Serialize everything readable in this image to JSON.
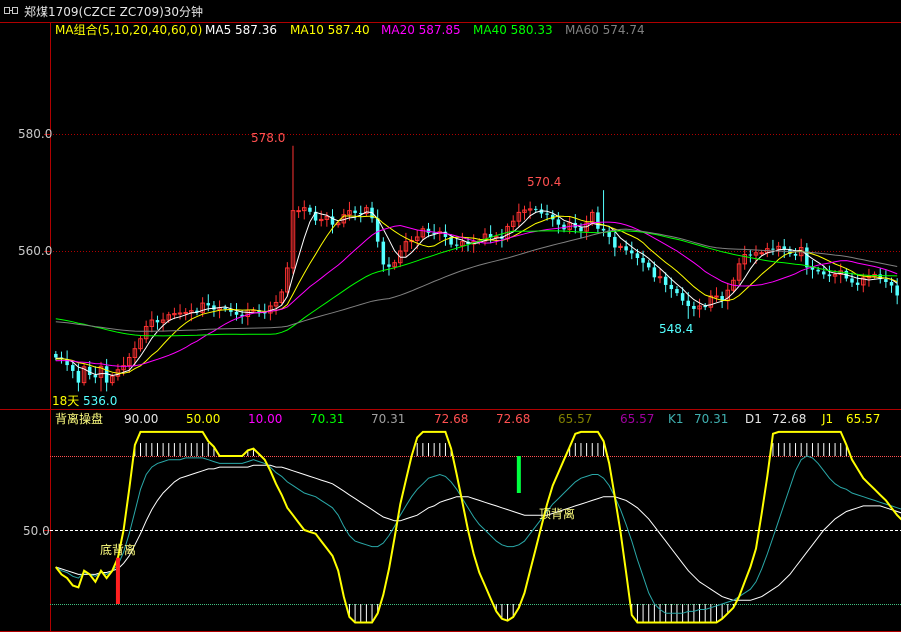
{
  "window_title": "郑煤1709(CZCE ZC709)30分钟",
  "colors": {
    "background": "#000000",
    "axis": "#b00000",
    "up_candle": "#ff3232",
    "down_candle": "#54ffff",
    "ma5": "#ffffff",
    "ma10": "#ffff00",
    "ma20": "#ff00ff",
    "ma40": "#00ff00",
    "ma60": "#808080",
    "k_line": "#ffff00",
    "d_line": "#ffffff",
    "j_line": "#2aa8a8"
  },
  "main_panel": {
    "ma_legend": {
      "group_label": "MA组合(5,10,20,40,60,0)",
      "ma5": "MA5 587.36",
      "ma10": "MA10 587.40",
      "ma20": "MA20 587.85",
      "ma40": "MA40 580.33",
      "ma60": "MA60 574.74"
    },
    "y_ticks": [
      "580.0",
      "560.0"
    ],
    "annotations": {
      "high1": "578.0",
      "high2": "570.4",
      "low1": "548.4",
      "low_days": "18天",
      "low_value": "536.0"
    }
  },
  "sub_panel": {
    "legend": [
      {
        "text": "背离操盘",
        "color": "#ffff80"
      },
      {
        "text": "90.00",
        "color": "#e6e6e6"
      },
      {
        "text": "50.00",
        "color": "#ffff00"
      },
      {
        "text": "10.00",
        "color": "#ff00ff"
      },
      {
        "text": "70.31",
        "color": "#00ff00"
      },
      {
        "text": "70.31",
        "color": "#a0a0a0"
      },
      {
        "text": "72.68",
        "color": "#ff5050"
      },
      {
        "text": "72.68",
        "color": "#ff5050"
      },
      {
        "text": "65.57",
        "color": "#808000"
      },
      {
        "text": "65.57",
        "color": "#a000a0"
      },
      {
        "text": "K1",
        "color": "#40b0b0"
      },
      {
        "text": "70.31",
        "color": "#40b0b0"
      },
      {
        "text": "D1",
        "color": "#e6e6e6"
      },
      {
        "text": "72.68",
        "color": "#e6e6e6"
      },
      {
        "text": "J1",
        "color": "#ffff00"
      },
      {
        "text": "65.57",
        "color": "#ffff00"
      }
    ],
    "y_tick": "50.0",
    "signals": {
      "bottom_divergence": "底背离",
      "top_divergence": "顶背离"
    }
  },
  "chart_data": [
    {
      "type": "candlestick",
      "title": "郑煤1709(CZCE ZC709)30分钟",
      "y_ticks": [
        560,
        580
      ],
      "ylim": [
        528,
        598
      ],
      "highest_marked": 578.0,
      "second_high_marked": 570.4,
      "low_marked": 548.4,
      "lowest_marked": 536.0,
      "close": [
        541.8,
        541.5,
        540.5,
        539.5,
        537.5,
        540.2,
        538.8,
        538.4,
        540.3,
        537.5,
        538.6,
        539.7,
        540.4,
        541.8,
        543.3,
        545.0,
        547.1,
        548.2,
        547.8,
        548.2,
        549.1,
        549.3,
        549.4,
        549.5,
        549.8,
        549.5,
        551.1,
        550.7,
        550.0,
        550.3,
        550.1,
        549.6,
        549.1,
        548.8,
        549.9,
        549.9,
        549.5,
        549.4,
        550.6,
        551.2,
        553.0,
        557.1,
        566.9,
        566.9,
        567.4,
        566.7,
        565.2,
        565.4,
        565.9,
        564.5,
        564.8,
        566.2,
        566.9,
        566.5,
        566.4,
        567.4,
        565.6,
        561.6,
        557.7,
        557.3,
        558.0,
        560.0,
        561.6,
        561.8,
        562.4,
        563.8,
        563.1,
        563.0,
        563.3,
        562.4,
        561.1,
        560.9,
        561.6,
        561.2,
        561.6,
        561.7,
        562.9,
        562.3,
        562.5,
        562.1,
        564.2,
        565.1,
        566.6,
        567.0,
        567.2,
        567.1,
        566.4,
        566.2,
        565.4,
        564.5,
        563.7,
        564.8,
        564.0,
        563.4,
        564.8,
        566.6,
        563.8,
        563.5,
        562.4,
        560.6,
        560.8,
        560.1,
        559.6,
        558.8,
        558.0,
        557.2,
        555.5,
        555.6,
        554.2,
        553.5,
        552.8,
        551.5,
        550.6,
        550.1,
        550.6,
        550.4,
        552.3,
        552.3,
        551.5,
        553.3,
        555.0,
        557.8,
        559.4,
        559.3,
        559.7,
        559.7,
        560.4,
        560.3,
        560.8,
        560.3,
        559.5,
        559.2,
        560.6,
        557.2,
        556.8,
        556.5,
        556.0,
        555.7,
        556.0,
        556.6,
        555.3,
        554.6,
        554.2,
        555.4,
        555.7,
        556.0,
        555.2,
        554.7,
        554.1,
        552.4
      ]
    },
    {
      "type": "line",
      "title": "背离操盘",
      "y_tick": 50,
      "reference_levels": [
        90,
        50,
        10
      ],
      "series": [
        {
          "name": "K1",
          "values": [
            30,
            28,
            27,
            25,
            24,
            27,
            26,
            25,
            27,
            26,
            28,
            31,
            38,
            48,
            60,
            72,
            80,
            84,
            86,
            87,
            88,
            88,
            88,
            89,
            89,
            89,
            89,
            88,
            87,
            86,
            86,
            86,
            86,
            86,
            87,
            88,
            87,
            86,
            84,
            81,
            79,
            76,
            74,
            72,
            70,
            69,
            68,
            66,
            64,
            62,
            58,
            52,
            47,
            44,
            43,
            42,
            41,
            41,
            43,
            47,
            52,
            58,
            63,
            68,
            72,
            75,
            78,
            79,
            80,
            79,
            76,
            72,
            67,
            62,
            57,
            53,
            50,
            47,
            44,
            42,
            41,
            41,
            42,
            44,
            48,
            52,
            56,
            60,
            64,
            67,
            70,
            73,
            76,
            78,
            79,
            80,
            80,
            78,
            74,
            68,
            61,
            53,
            44,
            34,
            25,
            16,
            10,
            7,
            5,
            5,
            5,
            5,
            6,
            6,
            7,
            7,
            8,
            9,
            10,
            11,
            12,
            14,
            16,
            18,
            22,
            29,
            37,
            46,
            55,
            64,
            73,
            82,
            88,
            90,
            89,
            86,
            82,
            78,
            75,
            73,
            72,
            70,
            69,
            68,
            67,
            66,
            65,
            64,
            63,
            62,
            61
          ]
        },
        {
          "name": "D1",
          "values": [
            30,
            29,
            28,
            27,
            26,
            26,
            26,
            26,
            27,
            27,
            28,
            29,
            32,
            36,
            42,
            48,
            55,
            61,
            66,
            70,
            73,
            76,
            78,
            79,
            80,
            81,
            82,
            83,
            83,
            84,
            84,
            84,
            84,
            84,
            84,
            85,
            85,
            85,
            85,
            84,
            84,
            83,
            82,
            81,
            80,
            79,
            78,
            77,
            76,
            75,
            73,
            71,
            69,
            67,
            65,
            63,
            61,
            59,
            57,
            56,
            55,
            55,
            56,
            57,
            58,
            60,
            62,
            63,
            65,
            66,
            67,
            68,
            68,
            68,
            67,
            66,
            65,
            64,
            63,
            62,
            61,
            60,
            59,
            58,
            58,
            58,
            58,
            58,
            59,
            60,
            61,
            62,
            63,
            64,
            65,
            66,
            67,
            68,
            68,
            68,
            67,
            66,
            64,
            62,
            59,
            56,
            52,
            48,
            44,
            40,
            36,
            32,
            28,
            25,
            22,
            20,
            18,
            16,
            14,
            13,
            12,
            12,
            12,
            12,
            13,
            14,
            16,
            18,
            20,
            23,
            26,
            30,
            34,
            38,
            42,
            46,
            50,
            53,
            56,
            58,
            60,
            61,
            62,
            63,
            63,
            63,
            63,
            62,
            61,
            60,
            59
          ]
        },
        {
          "name": "J1",
          "values": [
            30,
            26,
            24,
            20,
            19,
            28,
            26,
            22,
            28,
            24,
            28,
            35,
            50,
            72,
            96,
            120,
            130,
            130,
            126,
            121,
            118,
            112,
            108,
            109,
            107,
            105,
            103,
            98,
            95,
            90,
            90,
            90,
            90,
            90,
            93,
            94,
            91,
            88,
            82,
            75,
            69,
            62,
            58,
            54,
            50,
            49,
            48,
            44,
            40,
            36,
            28,
            14,
            3,
            0,
            0,
            0,
            0,
            5,
            15,
            29,
            46,
            64,
            77,
            90,
            100,
            105,
            110,
            111,
            110,
            105,
            94,
            80,
            65,
            50,
            37,
            27,
            20,
            13,
            6,
            2,
            1,
            3,
            8,
            16,
            28,
            40,
            52,
            64,
            74,
            81,
            88,
            95,
            102,
            106,
            107,
            108,
            106,
            98,
            86,
            68,
            49,
            27,
            4,
            0,
            0,
            0,
            0,
            0,
            0,
            0,
            0,
            0,
            0,
            0,
            0,
            0,
            0,
            0,
            2,
            5,
            8,
            14,
            22,
            30,
            40,
            59,
            79,
            102,
            125,
            146,
            167,
            186,
            196,
            194,
            183,
            166,
            146,
            128,
            113,
            103,
            96,
            88,
            83,
            78,
            75,
            72,
            69,
            66,
            62,
            58,
            55
          ]
        }
      ],
      "signals": [
        {
          "label": "底背离",
          "index": 11
        },
        {
          "label": "顶背离",
          "index": 82
        }
      ]
    }
  ]
}
